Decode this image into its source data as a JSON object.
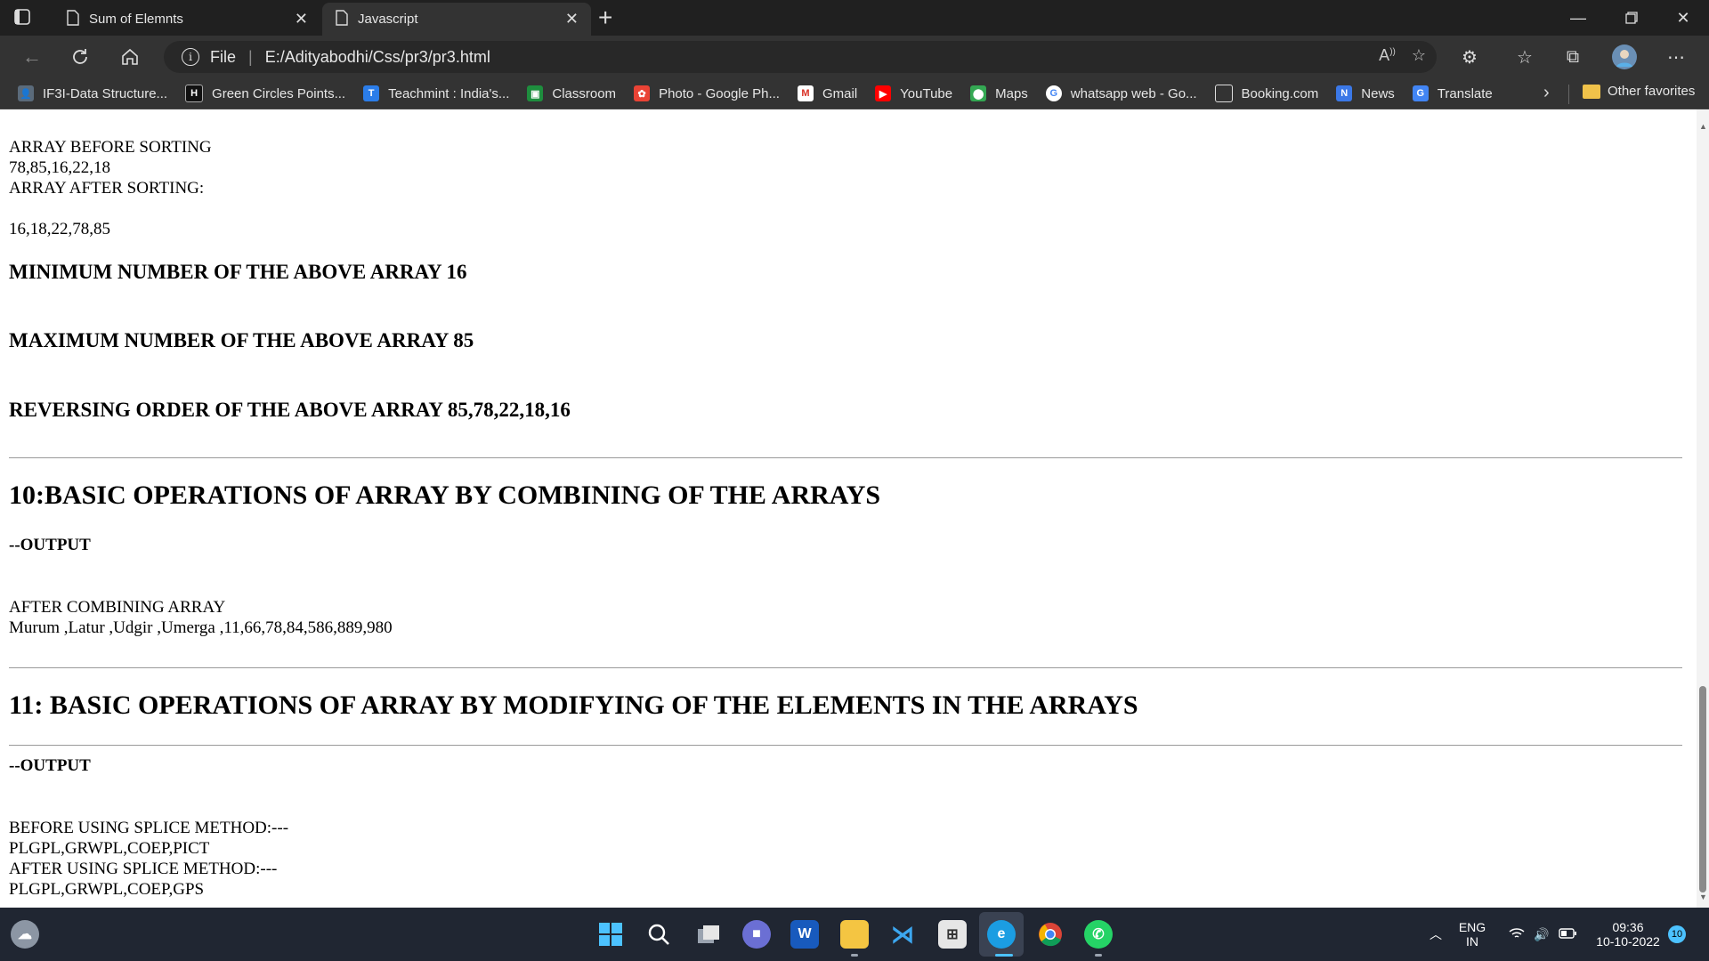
{
  "tabs": [
    {
      "label": "Sum of Elemnts",
      "active": false
    },
    {
      "label": "Javascript",
      "active": true
    }
  ],
  "address": {
    "scheme_label": "File",
    "url": "E:/Adityabodhi/Css/pr3/pr3.html"
  },
  "favorites": [
    {
      "label": "IF3I-Data Structure...",
      "icon": "user-icon",
      "color": "#5b6b7b"
    },
    {
      "label": "Green Circles Points...",
      "icon": "hc-icon",
      "color": "#111111"
    },
    {
      "label": "Teachmint : India's...",
      "icon": "teachmint-icon",
      "color": "#2b7de9"
    },
    {
      "label": "Classroom",
      "icon": "classroom-icon",
      "color": "#1e8e3e"
    },
    {
      "label": "Photo - Google Ph...",
      "icon": "photos-icon",
      "color": "#ea4335"
    },
    {
      "label": "Gmail",
      "icon": "gmail-icon",
      "color": "#d93025"
    },
    {
      "label": "YouTube",
      "icon": "youtube-icon",
      "color": "#ff0000"
    },
    {
      "label": "Maps",
      "icon": "maps-icon",
      "color": "#34a853"
    },
    {
      "label": "whatsapp web - Go...",
      "icon": "google-icon",
      "color": "#4285f4"
    },
    {
      "label": "Booking.com",
      "icon": "page-icon",
      "color": "#333333"
    },
    {
      "label": "News",
      "icon": "news-icon",
      "color": "#3b78e7"
    },
    {
      "label": "Translate",
      "icon": "translate-icon",
      "color": "#4285f4"
    }
  ],
  "favorites_other": "Other favorites",
  "page": {
    "array_before_label": "ARRAY BEFORE SORTING",
    "array_before": "78,85,16,22,18",
    "array_after_label": "ARRAY AFTER SORTING:",
    "array_after": "16,18,22,78,85",
    "minimum": "MINIMUM NUMBER OF THE ABOVE ARRAY 16",
    "maximum": "MAXIMUM NUMBER OF THE ABOVE ARRAY 85",
    "reverse": "REVERSING ORDER OF THE ABOVE ARRAY 85,78,22,18,16",
    "section10_title": "10:BASIC OPERATIONS OF ARRAY BY COMBINING OF THE ARRAYS",
    "output_label": "--OUTPUT",
    "combined_label": "AFTER COMBINING ARRAY",
    "combined_values": "Murum ,Latur ,Udgir ,Umerga ,11,66,78,84,586,889,980",
    "section11_title": "11: BASIC OPERATIONS OF ARRAY BY MODIFYING OF THE ELEMENTS IN THE ARRAYS",
    "before_splice_label": "BEFORE USING SPLICE METHOD:---",
    "before_splice": "PLGPL,GRWPL,COEP,PICT",
    "after_splice_label": "AFTER USING SPLICE METHOD:---",
    "after_splice": "PLGPL,GRWPL,COEP,GPS"
  },
  "tray": {
    "lang": "ENG",
    "region": "IN",
    "time": "09:36",
    "date": "10-10-2022",
    "notifications": "10"
  },
  "taskbar_apps": [
    "start-icon",
    "search-icon",
    "task-view-icon",
    "chat-icon",
    "word-icon",
    "file-explorer-icon",
    "vscode-icon",
    "store-icon",
    "edge-icon",
    "chrome-icon",
    "whatsapp-icon"
  ]
}
